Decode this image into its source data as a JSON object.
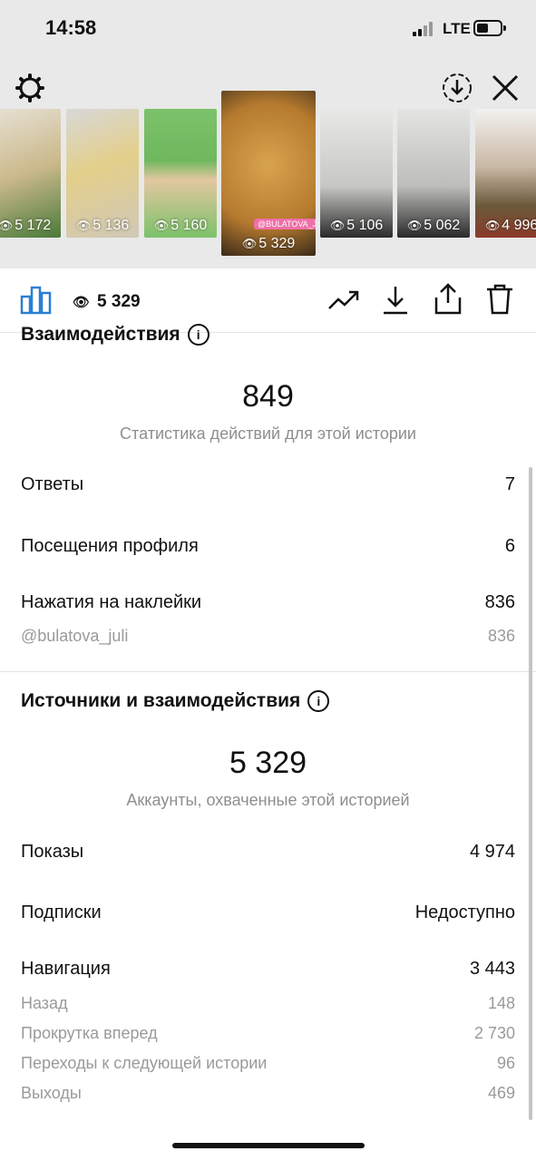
{
  "status_bar": {
    "time": "14:58",
    "network": "LTE"
  },
  "stories": [
    {
      "views": "5 172"
    },
    {
      "views": "5 136"
    },
    {
      "views": "5 160"
    },
    {
      "views": "5 329",
      "selected": true,
      "tag": "@BULATOVA_JULI"
    },
    {
      "views": "5 106"
    },
    {
      "views": "5 062"
    },
    {
      "views": "4 996"
    }
  ],
  "toolbar": {
    "views": "5 329"
  },
  "interactions": {
    "title": "Взаимодействия",
    "total": "849",
    "caption": "Статистика действий для этой истории",
    "rows": [
      {
        "label": "Ответы",
        "value": "7"
      },
      {
        "label": "Посещения профиля",
        "value": "6"
      },
      {
        "label": "Нажатия на наклейки",
        "value": "836"
      }
    ],
    "sub_rows": [
      {
        "label": "@bulatova_juli",
        "value": "836"
      }
    ]
  },
  "reach": {
    "title": "Источники и взаимодействия",
    "total": "5 329",
    "caption": "Аккаунты, охваченные этой историей",
    "rows": [
      {
        "label": "Показы",
        "value": "4 974"
      },
      {
        "label": "Подписки",
        "value": "Недоступно"
      },
      {
        "label": "Навигация",
        "value": "3 443"
      }
    ],
    "sub_rows": [
      {
        "label": "Назад",
        "value": "148"
      },
      {
        "label": "Прокрутка вперед",
        "value": "2 730"
      },
      {
        "label": "Переходы к следующей истории",
        "value": "96"
      },
      {
        "label": "Выходы",
        "value": "469"
      }
    ]
  }
}
